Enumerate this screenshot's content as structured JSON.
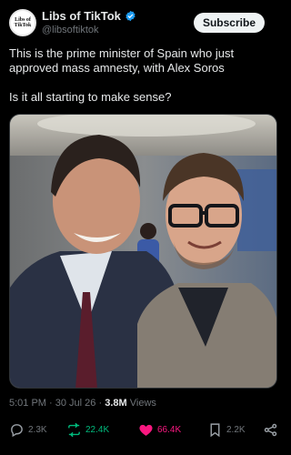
{
  "post": {
    "author": {
      "display_name": "Libs of TikTok",
      "handle": "@libsoftiktok",
      "verified": true,
      "avatar_text": "Libs of TikTok"
    },
    "subscribe_label": "Subscribe",
    "text_line1": "This is the prime minister of Spain who just approved mass amnesty, with Alex Soros",
    "text_line2": "Is it all starting to make sense?",
    "meta": {
      "time": "5:01 PM",
      "date": "30 Jul 26",
      "views": "3.8M",
      "views_label": "Views"
    },
    "actions": {
      "replies": "2.3K",
      "reposts": "22.4K",
      "likes": "66.4K",
      "bookmarks": "2.2K"
    }
  },
  "colors": {
    "background": "#000000",
    "text": "#e7e9ea",
    "muted": "#71767b",
    "verified": "#1d9bf0",
    "repost": "#00ba7c",
    "like": "#f91880"
  }
}
